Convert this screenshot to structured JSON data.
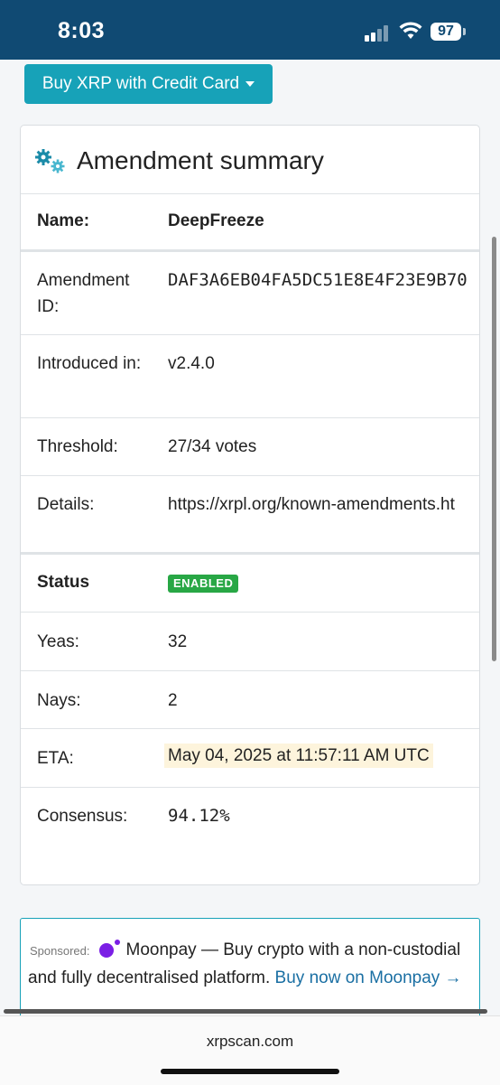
{
  "status_bar": {
    "time": "8:03",
    "battery": "97"
  },
  "buy_button": {
    "label": "Buy XRP with Credit Card"
  },
  "card": {
    "title": "Amendment summary",
    "rows": {
      "name": {
        "label": "Name:",
        "value": "DeepFreeze"
      },
      "amendment_id": {
        "label": "Amendment ID:",
        "value": "DAF3A6EB04FA5DC51E8E4F23E9B70"
      },
      "introduced": {
        "label": "Introduced in:",
        "value": "v2.4.0"
      },
      "threshold": {
        "label": "Threshold:",
        "value": "27/34 votes"
      },
      "details": {
        "label": "Details:",
        "value": "https://xrpl.org/known-amendments.ht"
      },
      "status": {
        "label": "Status",
        "value": "ENABLED"
      },
      "yeas": {
        "label": "Yeas:",
        "value": "32"
      },
      "nays": {
        "label": "Nays:",
        "value": "2"
      },
      "eta": {
        "label": "ETA:",
        "value": "May 04, 2025 at 11:57:11 AM UTC"
      },
      "consensus": {
        "label": "Consensus:",
        "value": "94.12%"
      }
    },
    "colors": {
      "accent": "#17a2b8",
      "link": "#1a6fa3",
      "enabled": "#28a745",
      "header": "#104a73"
    }
  },
  "sponsor": {
    "label": "Sponsored:",
    "brand": "Moonpay",
    "text": " — Buy crypto with a non-custodial and fully decentralised platform. ",
    "cta": "Buy now on Moonpay →"
  },
  "browser": {
    "url": "xrpscan.com"
  }
}
